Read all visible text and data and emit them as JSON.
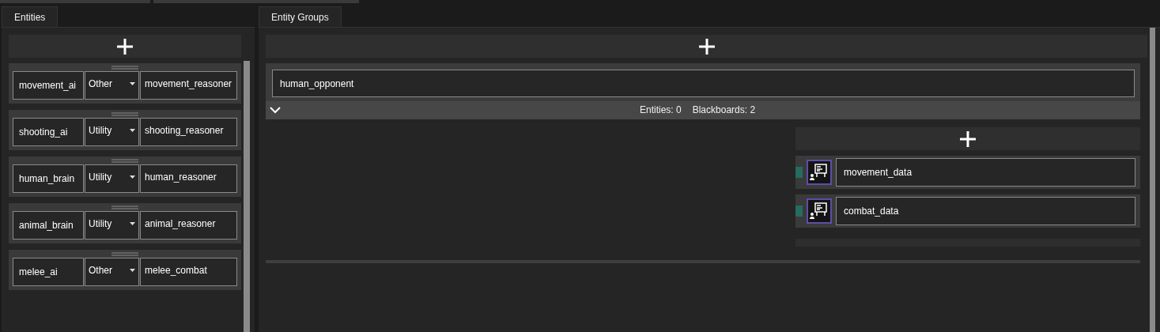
{
  "left_panel": {
    "tab": {
      "label": "Entities",
      "selected": true
    },
    "entities": [
      {
        "name": "movement_ai",
        "type": "Other",
        "reasoner": "movement_reasoner"
      },
      {
        "name": "shooting_ai",
        "type": "Utility",
        "reasoner": "shooting_reasoner"
      },
      {
        "name": "human_brain",
        "type": "Utility",
        "reasoner": "human_reasoner"
      },
      {
        "name": "animal_brain",
        "type": "Utility",
        "reasoner": "animal_reasoner"
      },
      {
        "name": "melee_ai",
        "type": "Other",
        "reasoner": "melee_combat"
      }
    ]
  },
  "right_panel": {
    "tab": {
      "label": "Entity Groups",
      "selected": true
    },
    "groups": [
      {
        "name": "human_opponent",
        "expanded": true,
        "entities_count": "Entities: 0",
        "blackboards_count": "Blackboards: 2",
        "blackboards": [
          {
            "name": "movement_data"
          },
          {
            "name": "combat_data"
          }
        ]
      }
    ]
  }
}
